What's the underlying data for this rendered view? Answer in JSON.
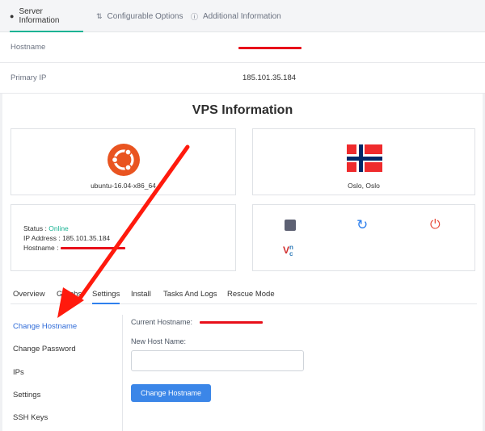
{
  "top_tabs": [
    {
      "label": "Server Information",
      "icon": "map-pin-icon",
      "active": true
    },
    {
      "label": "Configurable Options",
      "icon": "sliders-icon",
      "active": false
    },
    {
      "label": "Additional Information",
      "icon": "info-icon",
      "active": false
    }
  ],
  "info": {
    "hostname_label": "Hostname",
    "primary_ip_label": "Primary IP",
    "primary_ip_value": "185.101.35.184"
  },
  "vps": {
    "title": "VPS Information",
    "os_name": "ubuntu-16.04-x86_64",
    "location": "Oslo, Oslo",
    "status_label": "Status :",
    "status_value": "Online",
    "ip_label": "IP Address :",
    "ip_value": "185.101.35.184",
    "hostname_label": "Hostname :",
    "actions": [
      "stop-icon",
      "reboot-icon",
      "power-icon",
      "vnc-icon"
    ]
  },
  "sub_tabs": [
    "Overview",
    "Graphs",
    "Settings",
    "Install",
    "Tasks And Logs",
    "Rescue Mode"
  ],
  "side_menu": [
    "Change Hostname",
    "Change Password",
    "IPs",
    "Settings",
    "SSH Keys"
  ],
  "form": {
    "current_hostname_label": "Current Hostname:",
    "new_host_label": "New Host Name:",
    "new_host_value": "",
    "submit_label": "Change Hostname"
  },
  "colors": {
    "accent_green": "#1bb394",
    "primary_blue": "#3b86e8",
    "redaction_red": "#e8101a",
    "ubuntu_orange": "#e95420"
  }
}
